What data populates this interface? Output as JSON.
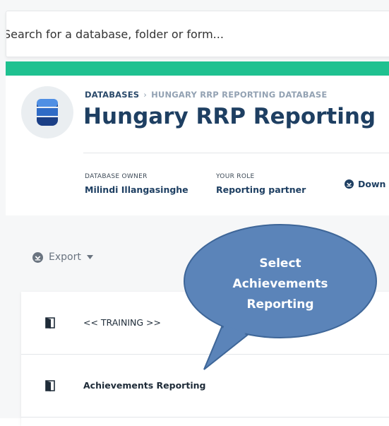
{
  "search": {
    "placeholder": "Search for a database, folder or form..."
  },
  "header": {
    "breadcrumb": {
      "root": "DATABASES",
      "separator": "›",
      "current": "HUNGARY RRP REPORTING DATABASE"
    },
    "title": "Hungary RRP Reporting",
    "icon": "database-icon",
    "meta": [
      {
        "label": "DATABASE OWNER",
        "value": "Milindi Illangasinghe"
      },
      {
        "label": "YOUR ROLE",
        "value": "Reporting partner"
      }
    ],
    "download_label": "Down"
  },
  "toolbar": {
    "export_label": "Export",
    "export_icon": "download-circle-icon",
    "dropdown_icon": "caret-down-icon"
  },
  "list": {
    "items": [
      {
        "label": "<< TRAINING >>",
        "icon": "form-icon"
      },
      {
        "label": "Achievements Reporting",
        "icon": "form-icon"
      }
    ]
  },
  "callout": {
    "lines": [
      "Select",
      "Achievements",
      "Reporting"
    ]
  },
  "colors": {
    "accent_green": "#1fc190",
    "title_navy": "#1e3f62",
    "callout_fill": "#5b84b9",
    "callout_stroke": "#3e6698"
  }
}
